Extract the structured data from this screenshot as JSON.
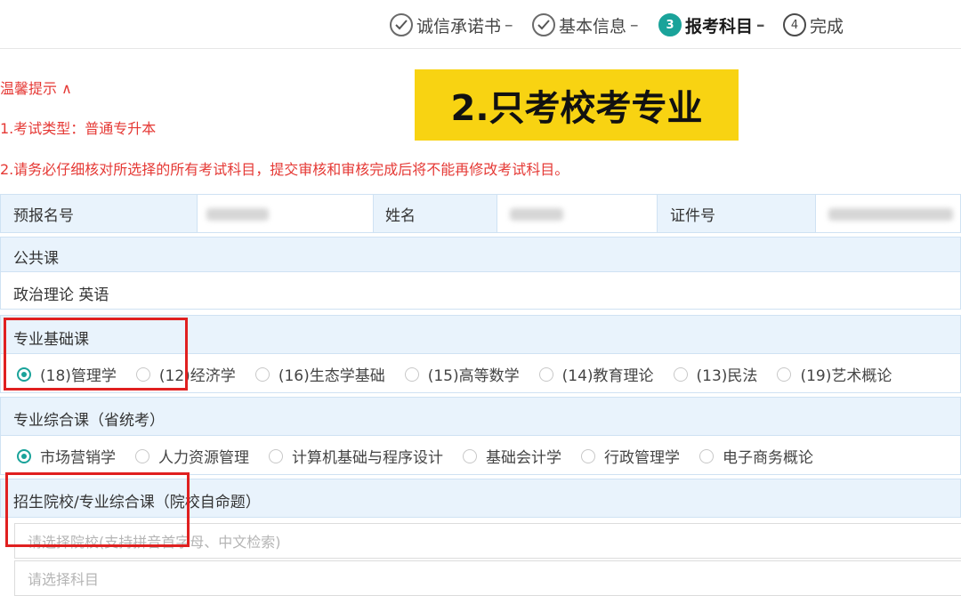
{
  "steps": [
    {
      "label": "诚信承诺书",
      "marker": "check-icon",
      "sep": "–"
    },
    {
      "label": "基本信息",
      "marker": "check-icon",
      "sep": "–"
    },
    {
      "label": "报考科目",
      "number": "3",
      "sep": "–"
    },
    {
      "label": "完成",
      "number": "4",
      "sep": ""
    }
  ],
  "tips": {
    "title": "温馨提示 ∧",
    "line1": "1.考试类型：普通专升本",
    "line2": "2.请务必仔细核对所选择的所有考试科目，提交审核和审核完成后将不能再修改考试科目。"
  },
  "banner": "2.只考校考专业",
  "info": {
    "reg_label": "预报名号",
    "name_label": "姓名",
    "id_label": "证件号"
  },
  "public_course": {
    "title": "公共课",
    "value": "政治理论   英语"
  },
  "basic_course": {
    "title": "专业基础课",
    "options": [
      "(18)管理学",
      "(12)经济学",
      "(16)生态学基础",
      "(15)高等数学",
      "(14)教育理论",
      "(13)民法",
      "(19)艺术概论"
    ],
    "selected": 0
  },
  "comprehensive_course": {
    "title": "专业综合课（省统考）",
    "options": [
      "市场营销学",
      "人力资源管理",
      "计算机基础与程序设计",
      "基础会计学",
      "行政管理学",
      "电子商务概论"
    ],
    "selected": 0
  },
  "school_course": {
    "title": "招生院校/专业综合课（院校自命题）",
    "school_placeholder": "请选择院校(支持拼音首字母、中文检索)",
    "subject_placeholder": "请选择科目"
  },
  "colors": {
    "accent": "#1aa39a",
    "warning": "#e53935",
    "highlight": "#f8d312",
    "annotation": "#e02020"
  }
}
